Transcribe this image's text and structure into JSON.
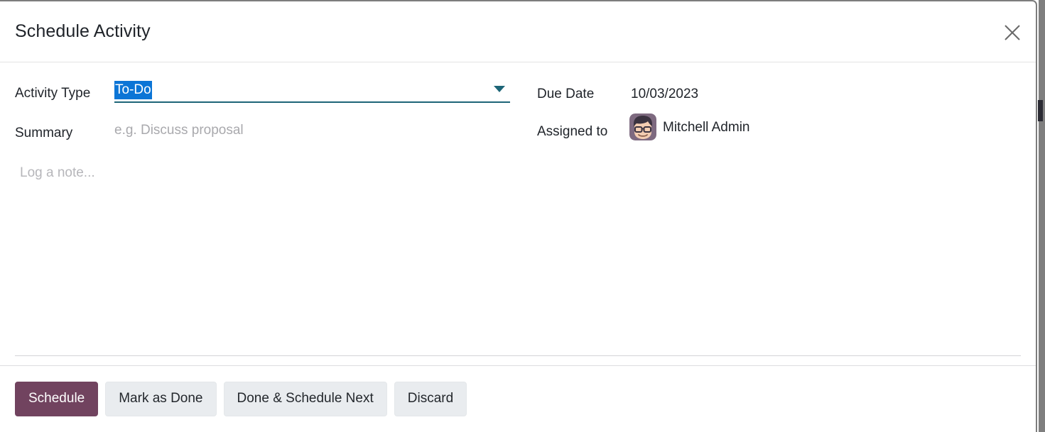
{
  "dialog": {
    "title": "Schedule Activity",
    "close_icon": "close-icon"
  },
  "form": {
    "activity_type": {
      "label": "Activity Type",
      "value": "To-Do",
      "selected": true,
      "dropdown_icon": "chevron-down-icon"
    },
    "summary": {
      "label": "Summary",
      "value": "",
      "placeholder": "e.g. Discuss proposal"
    },
    "due_date": {
      "label": "Due Date",
      "value": "10/03/2023"
    },
    "assigned_to": {
      "label": "Assigned to",
      "value": "Mitchell Admin",
      "avatar_icon": "user-avatar"
    },
    "note": {
      "value": "",
      "placeholder": "Log a note..."
    }
  },
  "footer": {
    "buttons": [
      {
        "label": "Schedule",
        "style": "primary"
      },
      {
        "label": "Mark as Done",
        "style": "secondary"
      },
      {
        "label": "Done & Schedule Next",
        "style": "secondary"
      },
      {
        "label": "Discard",
        "style": "secondary"
      }
    ]
  },
  "colors": {
    "primary": "#71435f",
    "secondary": "#e9ecef",
    "field_underline": "#1d6577",
    "text_selection": "#0c75d6",
    "text": "#1f2329",
    "placeholder": "#a9a9ad",
    "border": "#e3e3e3"
  }
}
